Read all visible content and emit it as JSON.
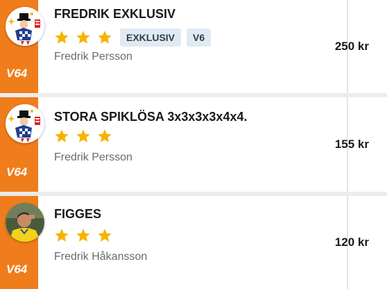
{
  "cards": [
    {
      "title": "FREDRIK EXKLUSIV",
      "rating": 3,
      "tags": [
        "EXKLUSIV",
        "V6"
      ],
      "author": "Fredrik Persson",
      "price": "250 kr",
      "game": "V64",
      "avatar": "mascot-avatar"
    },
    {
      "title": "STORA SPIKLÖSA 3x3x3x3x4x4.",
      "rating": 3,
      "tags": [],
      "author": "Fredrik Persson",
      "price": "155 kr",
      "game": "V64",
      "avatar": "mascot-avatar"
    },
    {
      "title": "FIGGES",
      "rating": 3,
      "tags": [],
      "author": "Fredrik Håkansson",
      "price": "120 kr",
      "game": "V64",
      "avatar": "person-photo-avatar"
    }
  ],
  "colors": {
    "accent_orange": "#f07d1c",
    "star_yellow": "#f5b400",
    "tag_bg": "#dfeaf3",
    "card_bg": "#ffffff",
    "page_bg": "#ececec"
  }
}
